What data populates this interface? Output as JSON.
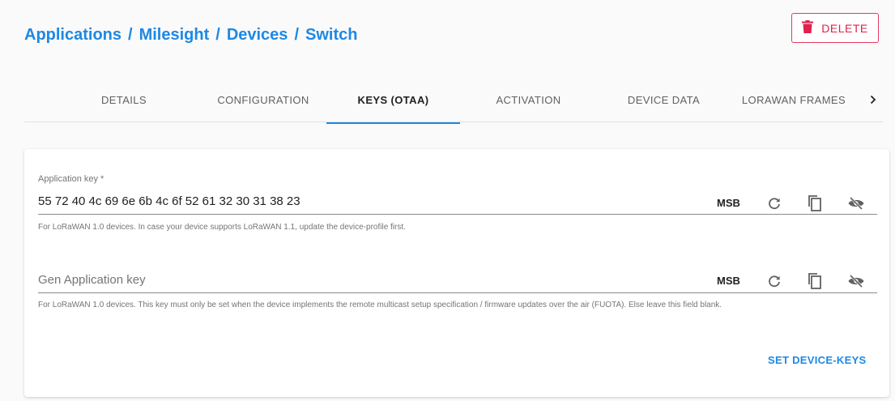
{
  "breadcrumb": {
    "items": [
      "Applications",
      "Milesight",
      "Devices",
      "Switch"
    ],
    "separator": "/"
  },
  "delete_button": {
    "label": "DELETE",
    "icon": "trash-icon",
    "color": "#e0204f"
  },
  "tabs": [
    {
      "label": "DETAILS",
      "active": false
    },
    {
      "label": "CONFIGURATION",
      "active": false
    },
    {
      "label": "KEYS (OTAA)",
      "active": true
    },
    {
      "label": "ACTIVATION",
      "active": false
    },
    {
      "label": "DEVICE DATA",
      "active": false
    },
    {
      "label": "LORAWAN FRAMES",
      "active": false
    }
  ],
  "tab_scroll_icon": "chevron-right-icon",
  "fields": [
    {
      "label": "Application key *",
      "value": "55 72 40 4c 69 6e 6b 4c 6f 52 61 32 30 31 38 23",
      "placeholder": "",
      "byte_order": "MSB",
      "helper": "For LoRaWAN 1.0 devices. In case your device supports LoRaWAN 1.1, update the device-profile first."
    },
    {
      "label": "",
      "value": "",
      "placeholder": "Gen Application key",
      "byte_order": "MSB",
      "helper": "For LoRaWAN 1.0 devices. This key must only be set when the device implements the remote multicast setup specification / firmware updates over the air (FUOTA). Else leave this field blank."
    }
  ],
  "field_icons": [
    "refresh-icon",
    "copy-icon",
    "visibility-off-icon"
  ],
  "submit_button": {
    "label": "SET DEVICE-KEYS"
  },
  "colors": {
    "accent": "#1e88e5",
    "danger": "#e0204f"
  }
}
